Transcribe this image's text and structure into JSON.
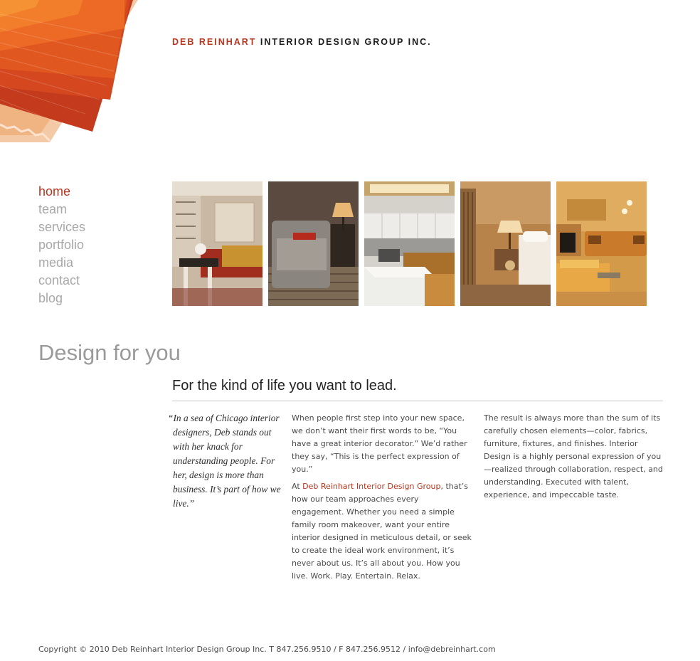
{
  "header": {
    "brand_name_red": "DEB REINHART",
    "brand_name_dark": " INTERIOR DESIGN GROUP INC."
  },
  "nav": {
    "items": [
      {
        "label": "home",
        "active": true
      },
      {
        "label": "team"
      },
      {
        "label": "services"
      },
      {
        "label": "portfolio"
      },
      {
        "label": "media"
      },
      {
        "label": "contact"
      },
      {
        "label": "blog"
      }
    ]
  },
  "gallery": {
    "photos": [
      {
        "subject": "living room with fireplace and sofa"
      },
      {
        "subject": "grey armchair with table lamp"
      },
      {
        "subject": "white kitchen with island"
      },
      {
        "subject": "bedroom with table lamp and window"
      },
      {
        "subject": "family room with sectional sofa and fireplace"
      }
    ]
  },
  "main": {
    "title": "Design for you",
    "tagline": "For the kind of life you want to lead.",
    "quote": "“In a sea of Chicago interior designers, Deb stands out with her knack for understanding people. For her, design is more than business. It’s part of how we live.”",
    "col2_p1": "When people first step into your new space, we don’t want their first words to be, “You have a great interior decorator.” We’d rather they say, “This is the perfect expression of you.”",
    "col2_p2_prefix": "At ",
    "col2_p2_link": "Deb Reinhart Interior Design Group",
    "col2_p2_suffix": ", that’s how our team approaches every engagement. Whether you need a simple family room makeover, want your entire interior designed in meticulous detail, or seek to create the ideal work environment, it’s never about us. It’s all about you. How you live. Work. Play. Entertain. Relax.",
    "col3_p1": "The result is always more than the sum of its carefully chosen elements—color, fabrics, furniture, fixtures, and finishes. Interior Design is a highly personal expression of you—realized through collaboration, respect, and understanding. Executed with talent, experience, and impeccable taste."
  },
  "footer": {
    "copyright": "Copyright © 2010 Deb Reinhart Interior Design Group Inc. T 847.256.9510 / F 847.256.9512 / ",
    "email": "info@debreinhart.com"
  },
  "colors": {
    "accent": "#b5361f",
    "nav_inactive": "#a8a8a8",
    "body_text": "#4a4a4a"
  }
}
